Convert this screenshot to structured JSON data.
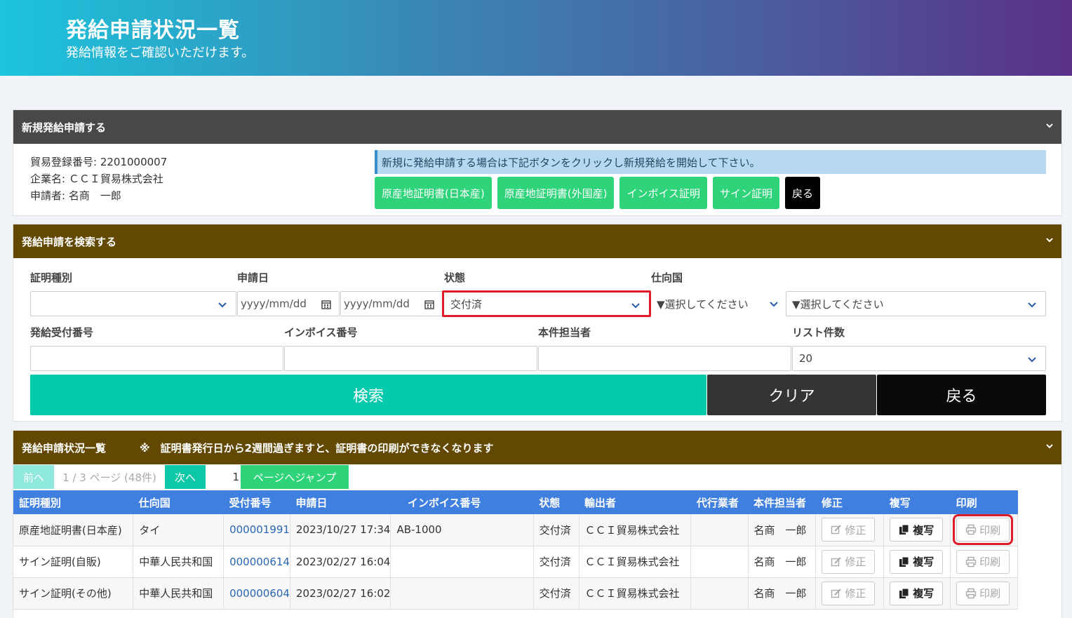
{
  "header": {
    "title": "発給申請状況一覧",
    "subtitle": "発給情報をご確認いただけます。"
  },
  "new_panel": {
    "title": "新規発給申請する",
    "trade_no": "貿易登録番号: 2201000007",
    "company": "企業名: ＣＣＩ貿易株式会社",
    "applicant": "申請者: 名商　一郎",
    "notice": "新規に発給申請する場合は下記ボタンをクリックし新規発給を開始して下さい。",
    "buttons": [
      "原産地証明書(日本産)",
      "原産地証明書(外国産)",
      "インボイス証明",
      "サイン証明"
    ],
    "back": "戻る"
  },
  "search_panel": {
    "title": "発給申請を検索する",
    "labels": {
      "cert_type": "証明種別",
      "apply_date": "申請日",
      "status": "状態",
      "destination": "仕向国",
      "receipt_no": "発給受付番号",
      "invoice_no": "インボイス番号",
      "person": "本件担当者",
      "list_count": "リスト件数"
    },
    "values": {
      "cert_type": "",
      "date_from_placeholder": "yyyy/mm/dd",
      "date_to_placeholder": "yyyy/mm/dd",
      "status": "交付済",
      "destination_region": "▼選択してください",
      "destination_country": "▼選択してください",
      "list_count": "20"
    },
    "buttons": {
      "search": "検索",
      "clear": "クリア",
      "back": "戻る"
    }
  },
  "list_panel": {
    "title": "発給申請状況一覧",
    "notice": "※　証明書発行日から2週間過ぎますと、証明書の印刷ができなくなります",
    "pager": {
      "prev": "前へ",
      "info": "1 / 3 ページ (48件)",
      "next": "次へ",
      "page_input": "1",
      "jump": "ページへジャンプ"
    },
    "columns": [
      "証明種別",
      "仕向国",
      "受付番号",
      "申請日",
      "インボイス番号",
      "状態",
      "輸出者",
      "代行業者",
      "本件担当者",
      "修正",
      "複写",
      "印刷"
    ],
    "rows": [
      {
        "type": "原産地証明書(日本産)",
        "dest": "タイ",
        "no": "000001991",
        "date": "2023/10/27 17:34",
        "invoice": "AB-1000",
        "status": "交付済",
        "exporter": "ＣＣＩ貿易株式会社",
        "agent": "",
        "person": "名商　一郎"
      },
      {
        "type": "サイン証明(自販)",
        "dest": "中華人民共和国",
        "no": "000000614",
        "date": "2023/02/27 16:04",
        "invoice": "",
        "status": "交付済",
        "exporter": "ＣＣＩ貿易株式会社",
        "agent": "",
        "person": "名商　一郎"
      },
      {
        "type": "サイン証明(その他)",
        "dest": "中華人民共和国",
        "no": "000000604",
        "date": "2023/02/27 16:02",
        "invoice": "",
        "status": "交付済",
        "exporter": "ＣＣＩ貿易株式会社",
        "agent": "",
        "person": "名商　一郎"
      }
    ],
    "actions": {
      "edit": "修正",
      "copy": "複写",
      "print": "印刷"
    }
  }
}
